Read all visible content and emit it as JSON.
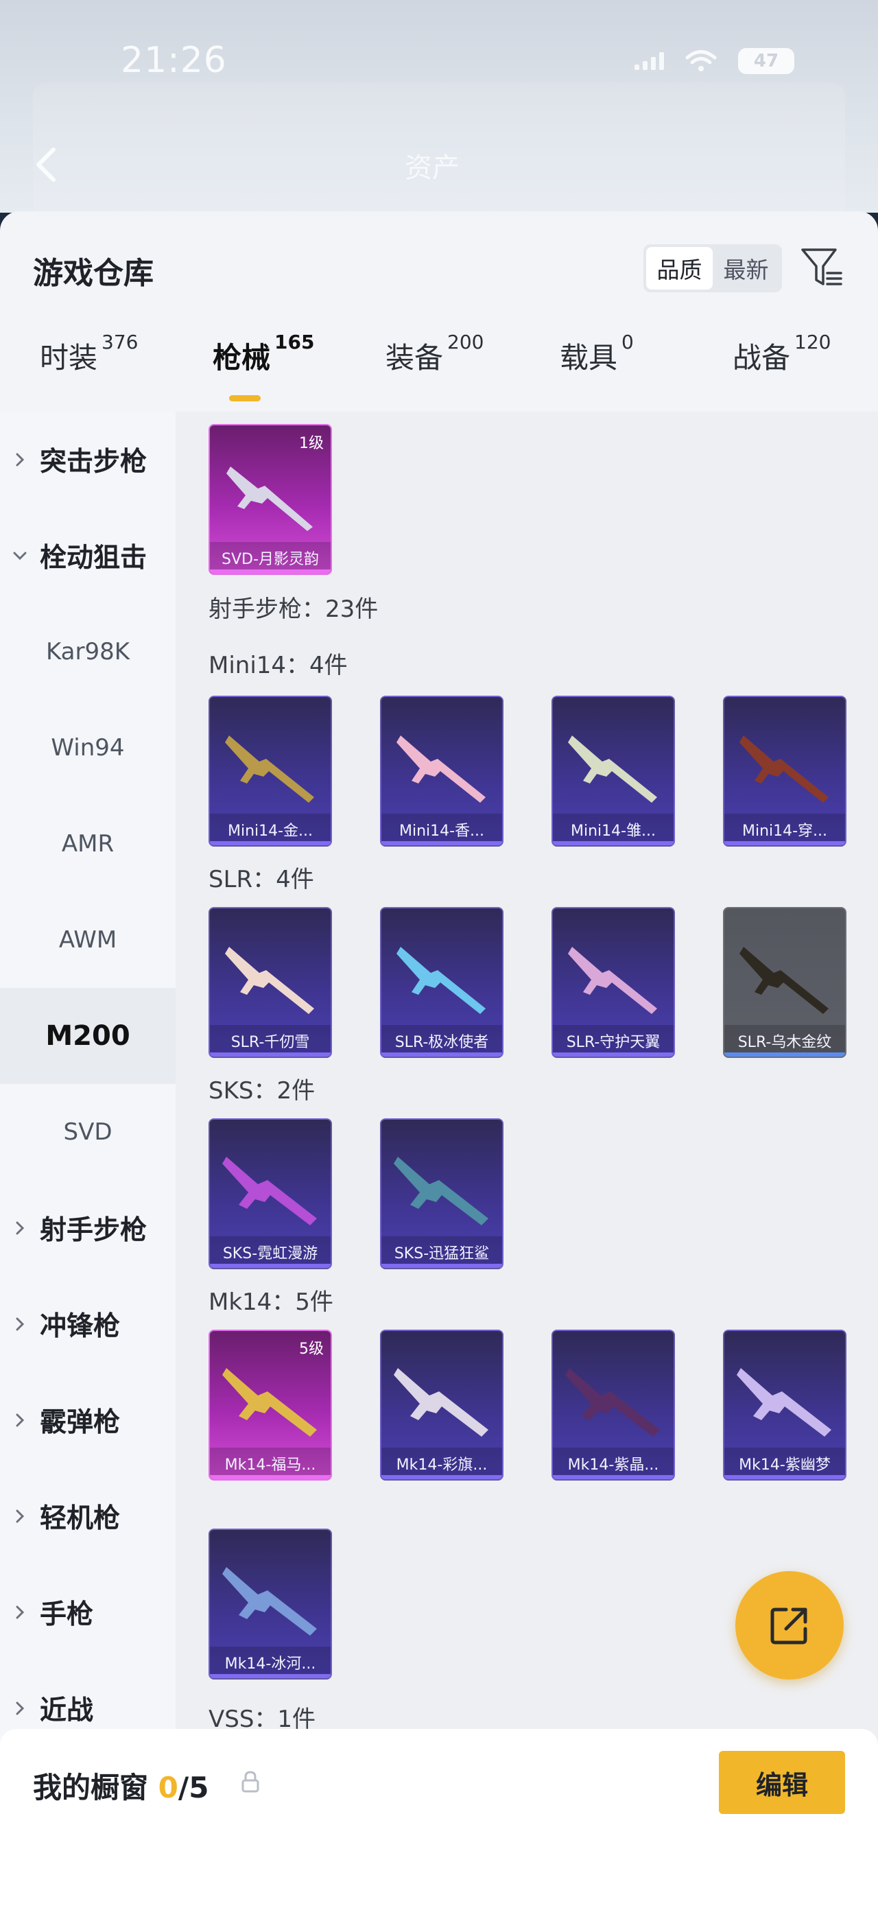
{
  "status_bar": {
    "time": "21:26",
    "battery": "47"
  },
  "header": {
    "title": "资产"
  },
  "sheet": {
    "title": "游戏仓库",
    "sort": {
      "options": [
        "品质",
        "最新"
      ],
      "active": "品质"
    }
  },
  "tabs": [
    {
      "label": "时装",
      "count": "376"
    },
    {
      "label": "枪械",
      "count": "165"
    },
    {
      "label": "装备",
      "count": "200"
    },
    {
      "label": "载具",
      "count": "0"
    },
    {
      "label": "战备",
      "count": "120"
    }
  ],
  "sidebar": {
    "cat_assault": "突击步枪",
    "cat_bolt": "栓动狙击",
    "subs": [
      "Kar98K",
      "Win94",
      "AMR",
      "AWM",
      "M200",
      "SVD"
    ],
    "active_sub": "M200",
    "cat_dmr": "射手步枪",
    "cat_smg": "冲锋枪",
    "cat_shotgun": "霰弹枪",
    "cat_lmg": "轻机枪",
    "cat_pistol": "手枪",
    "cat_melee": "近战"
  },
  "content": {
    "top_card": {
      "name": "SVD-月影灵韵",
      "level": "1级"
    },
    "dmr_total": "射手步枪：23件",
    "mini14_label": "Mini14：4件",
    "mini14_cards": [
      "Mini14-金...",
      "Mini14-香...",
      "Mini14-雏...",
      "Mini14-穿..."
    ],
    "slr_label": "SLR：4件",
    "slr_cards": [
      "SLR-千仞雪",
      "SLR-极冰使者",
      "SLR-守护天翼",
      "SLR-乌木金纹"
    ],
    "sks_label": "SKS：2件",
    "sks_cards": [
      "SKS-霓虹漫游",
      "SKS-迅猛狂鲨"
    ],
    "mk14_label": "Mk14：5件",
    "mk14_cards": [
      "Mk14-福马...",
      "Mk14-彩旗...",
      "Mk14-紫晶...",
      "Mk14-紫幽梦",
      "Mk14-冰河..."
    ],
    "mk14_level": "5级",
    "vss_label": "VSS：1件"
  },
  "bottom": {
    "showcase_label": "我的橱窗",
    "showcase_count": "0",
    "showcase_total": "/5",
    "edit_label": "编辑"
  },
  "colors": {
    "accent": "#f2b62a",
    "card_purple": "#3f3590",
    "card_pink": "#a52bb0",
    "card_grey": "#5e6069"
  }
}
